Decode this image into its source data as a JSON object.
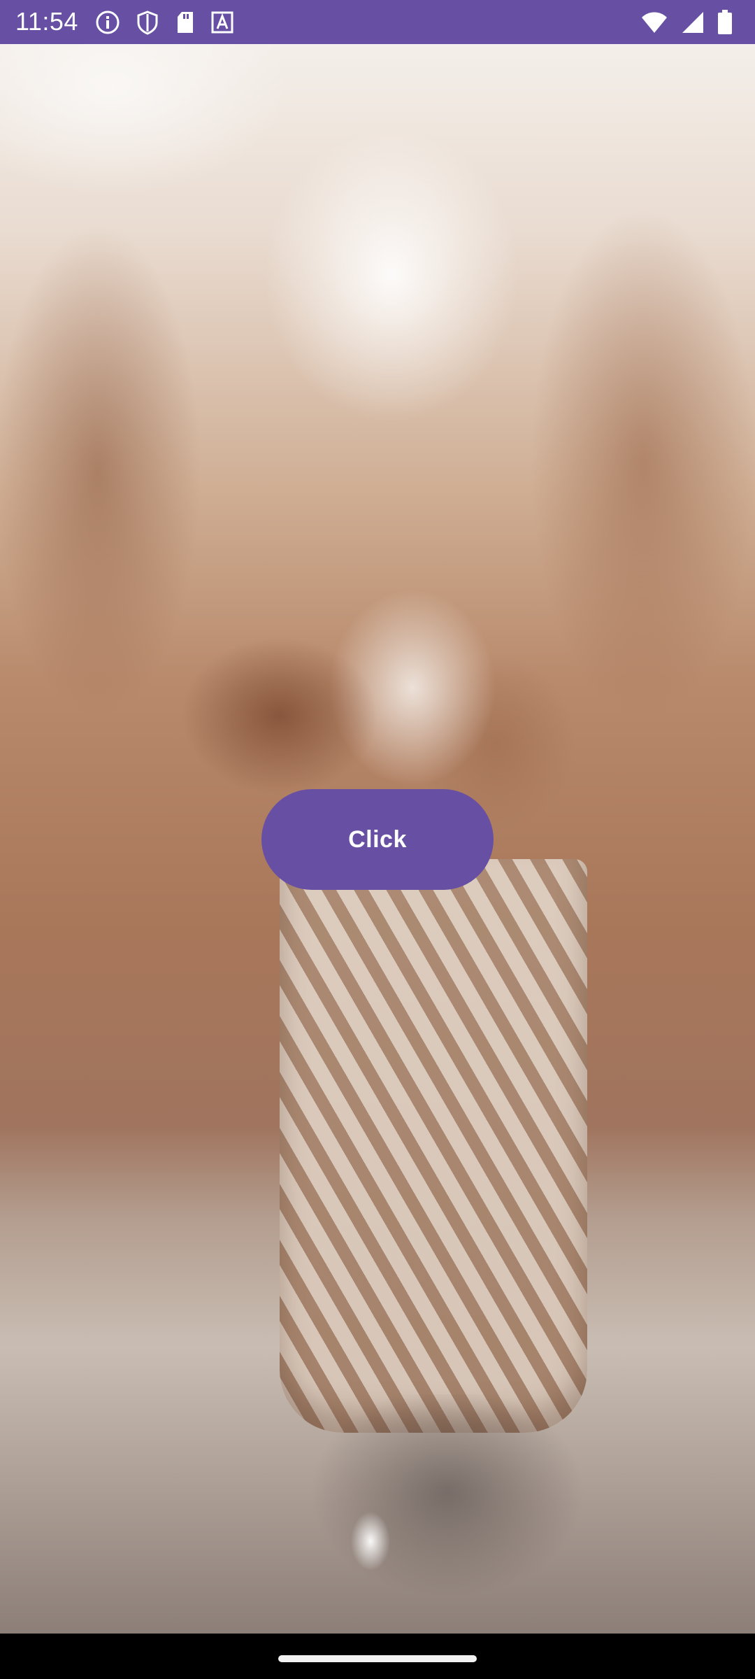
{
  "status_bar": {
    "time": "11:54",
    "left_icons": [
      "info-icon",
      "shield-icon",
      "sd-card-icon",
      "font-a-icon"
    ],
    "right_icons": [
      "wifi-icon",
      "signal-icon",
      "battery-icon"
    ],
    "background_color": "#6750a4"
  },
  "main": {
    "background_image": "dried-flowers-in-woven-basket-photo",
    "button": {
      "label": "Click",
      "color": "#6750a4",
      "text_color": "#ffffff"
    }
  },
  "navigation": {
    "gesture_handle": "gesture-navigation-handle"
  }
}
